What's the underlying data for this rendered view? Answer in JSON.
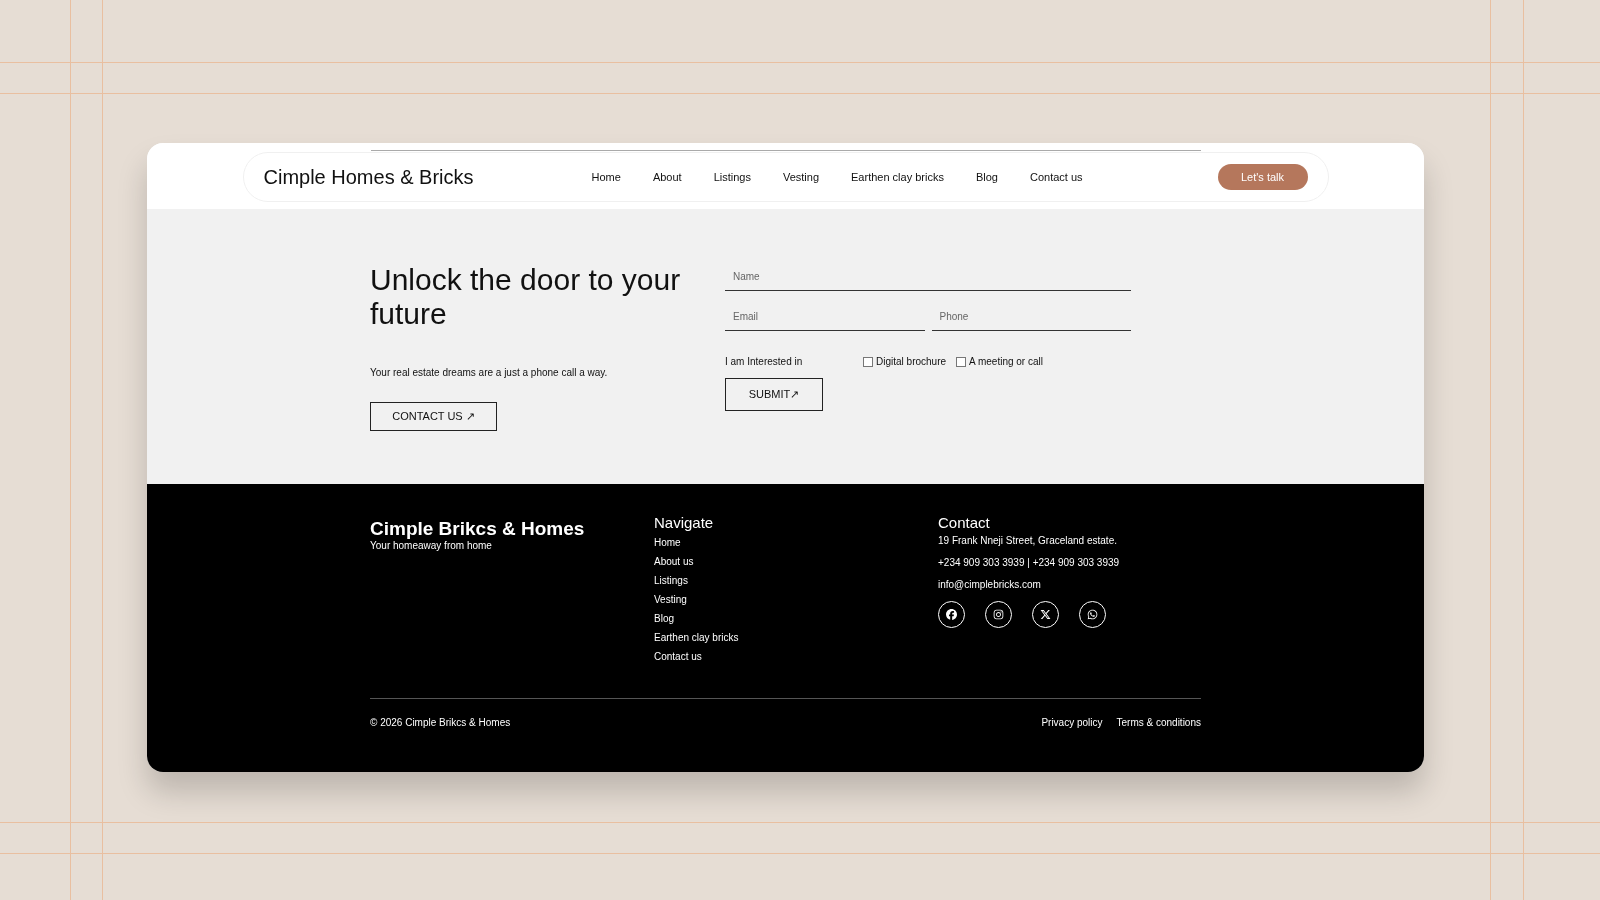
{
  "header": {
    "logo": "Cimple Homes & Bricks",
    "nav": [
      {
        "label": "Home"
      },
      {
        "label": "About"
      },
      {
        "label": "Listings"
      },
      {
        "label": "Vesting"
      },
      {
        "label": "Earthen clay bricks"
      },
      {
        "label": "Blog"
      },
      {
        "label": "Contact us"
      }
    ],
    "cta": "Let's talk"
  },
  "hero": {
    "title": "Unlock the door to your future",
    "subtitle": "Your real estate dreams are a just a phone call a way.",
    "button": "CONTACT US ↗"
  },
  "form": {
    "name": {
      "placeholder": "Name"
    },
    "email": {
      "placeholder": "Email"
    },
    "phone": {
      "placeholder": "Phone"
    },
    "interest_label": "I am Interested in",
    "options": [
      {
        "label": "Digital brochure",
        "checked": false
      },
      {
        "label": "A meeting or call",
        "checked": false
      }
    ],
    "submit": "SUBMIT↗"
  },
  "footer": {
    "brand": "Cimple Brikcs & Homes",
    "tagline": "Your homeaway from home",
    "navigate_title": "Navigate",
    "links": [
      "Home",
      "About us",
      "Listings",
      "Vesting",
      "Blog",
      "Earthen clay bricks",
      "Contact us"
    ],
    "contact_title": "Contact",
    "address": "19 Frank Nneji Street, Graceland estate.",
    "phones": "+234 909 303 3939 | +234 909 303 3939",
    "email": "info@cimplebricks.com",
    "socials": [
      {
        "kind": "facebook"
      },
      {
        "kind": "instagram"
      },
      {
        "kind": "x"
      },
      {
        "kind": "whatsapp"
      }
    ],
    "copyright": "© 2026 Cimple Brikcs & Homes",
    "legal": [
      "Privacy policy",
      "Terms & conditions"
    ]
  }
}
